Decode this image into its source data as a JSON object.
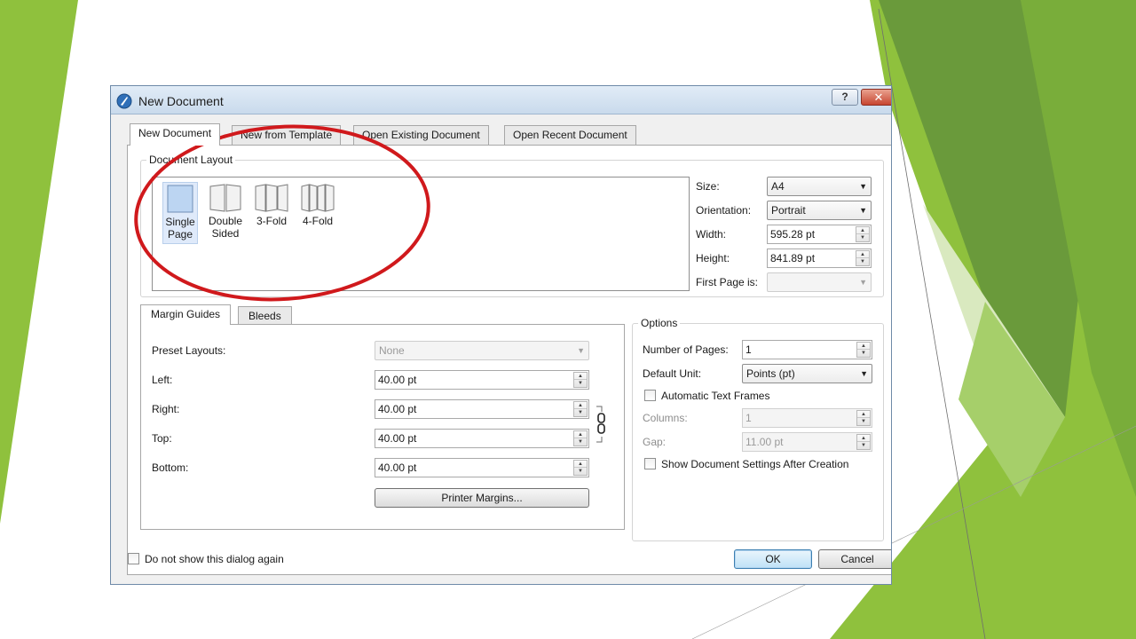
{
  "window": {
    "title": "New Document",
    "help_label": "?",
    "close_label": "✕"
  },
  "tabs": [
    {
      "label": "New Document",
      "active": true
    },
    {
      "label": "New from Template",
      "active": false
    },
    {
      "label": "Open Existing Document",
      "active": false
    },
    {
      "label": "Open Recent Document",
      "active": false
    }
  ],
  "document_layout": {
    "group_label": "Document Layout",
    "items": [
      {
        "label_line1": "Single",
        "label_line2": "Page",
        "selected": true,
        "icon": "single-page-icon"
      },
      {
        "label_line1": "Double",
        "label_line2": "Sided",
        "selected": false,
        "icon": "double-sided-icon"
      },
      {
        "label_line1": "3-Fold",
        "label_line2": "",
        "selected": false,
        "icon": "three-fold-icon"
      },
      {
        "label_line1": "4-Fold",
        "label_line2": "",
        "selected": false,
        "icon": "four-fold-icon"
      }
    ]
  },
  "page_settings": {
    "size_label": "Size:",
    "size_value": "A4",
    "orientation_label": "Orientation:",
    "orientation_value": "Portrait",
    "width_label": "Width:",
    "width_value": "595.28 pt",
    "height_label": "Height:",
    "height_value": "841.89 pt",
    "first_page_label": "First Page is:",
    "first_page_value": ""
  },
  "margins": {
    "tab_margin_guides": "Margin Guides",
    "tab_bleeds": "Bleeds",
    "preset_label": "Preset Layouts:",
    "preset_value": "None",
    "left_label": "Left:",
    "left_value": "40.00 pt",
    "right_label": "Right:",
    "right_value": "40.00 pt",
    "top_label": "Top:",
    "top_value": "40.00 pt",
    "bottom_label": "Bottom:",
    "bottom_value": "40.00 pt",
    "printer_margins_label": "Printer Margins..."
  },
  "options": {
    "group_label": "Options",
    "pages_label": "Number of Pages:",
    "pages_value": "1",
    "unit_label": "Default Unit:",
    "unit_value": "Points (pt)",
    "auto_text_frames_label": "Automatic Text Frames",
    "auto_text_frames_checked": false,
    "columns_label": "Columns:",
    "columns_value": "1",
    "gap_label": "Gap:",
    "gap_value": "11.00 pt",
    "show_settings_label": "Show Document Settings After Creation",
    "show_settings_checked": false
  },
  "footer": {
    "do_not_show_label": "Do not show this dialog again",
    "do_not_show_checked": false,
    "ok_label": "OK",
    "cancel_label": "Cancel"
  },
  "colors": {
    "annotation_circle": "#d0191c",
    "slide_green_dark": "#6f9c3a",
    "slide_green_light": "#8fc13d"
  }
}
